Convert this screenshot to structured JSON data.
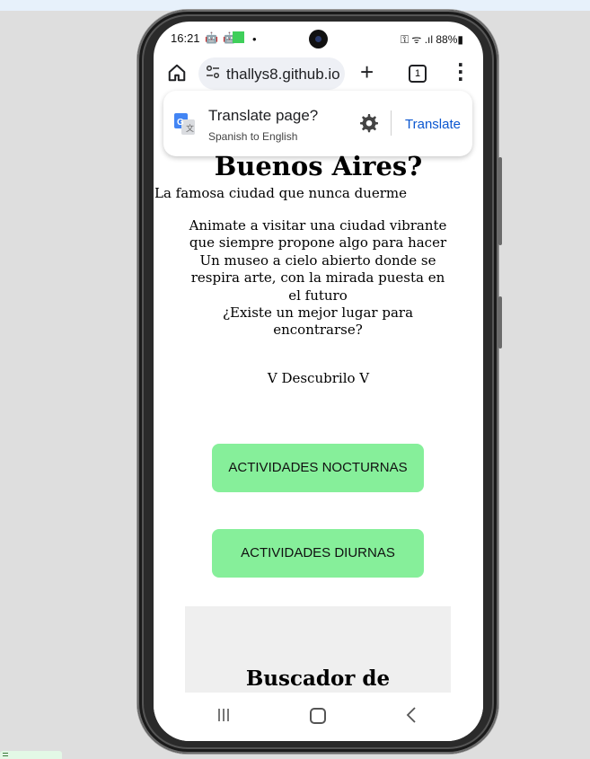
{
  "status_bar": {
    "time": "16:21",
    "app_icons": "🤖 🤖",
    "dot": "•",
    "right": "⚿ ᯤ .ıl 88%▮",
    "battery": "88%"
  },
  "browser": {
    "url": "thallys8.github.io",
    "tab_count": "1",
    "plus": "+",
    "menu": "⋮",
    "tune": "⚲"
  },
  "translate": {
    "title": "Translate page?",
    "subtitle": "Spanish to English",
    "button": "Translate"
  },
  "page": {
    "title": "Buenos Aires?",
    "subtitle": "La famosa ciudad que nunca duerme",
    "paragraph_lines": [
      "Animate a visitar una ciudad vibrante que siempre propone algo para hacer",
      "Un museo a cielo abierto donde se respira arte, con la mirada puesta en el futuro",
      "¿Existe un mejor lugar para encontrarse?"
    ],
    "discover": "V Descubrilo V",
    "btn_night": "ACTIVIDADES NOCTURNAS",
    "btn_day": "ACTIVIDADES DIURNAS",
    "search_title": "Buscador de"
  },
  "colors": {
    "button_green": "#86ef9a",
    "translate_blue": "#0b57d0"
  }
}
